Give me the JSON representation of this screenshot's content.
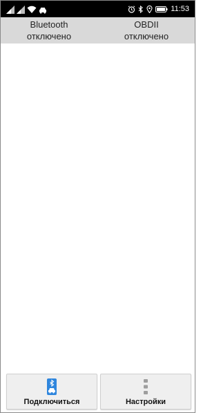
{
  "status_bar": {
    "time": "11:53",
    "left_icons": [
      "signal-icon",
      "signal-icon",
      "wifi-icon",
      "car-icon"
    ],
    "right_icons": [
      "alarm-icon",
      "bluetooth-icon",
      "location-icon",
      "battery-icon"
    ]
  },
  "header": {
    "bluetooth": {
      "title": "Bluetooth",
      "status": "отключено"
    },
    "obd": {
      "title": "OBDII",
      "status": "отключено"
    }
  },
  "buttons": {
    "connect": {
      "label": "Подключиться",
      "icon": "bluetooth-car-icon"
    },
    "settings": {
      "label": "Настройки",
      "icon": "settings-dots-icon"
    }
  },
  "colors": {
    "header_bg": "#d9d9d9",
    "status_bar_bg": "#000000",
    "button_bg": "#efefef",
    "accent_blue": "#2f86dd"
  }
}
